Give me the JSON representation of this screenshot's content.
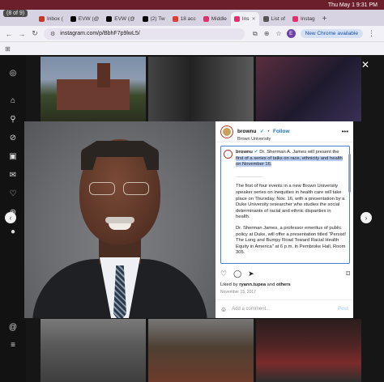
{
  "counter": "(8 of 9)",
  "menubar": {
    "datetime": "Thu May 1  9:31 PM"
  },
  "tabs": [
    {
      "label": "Inbox (",
      "color": "#c0392b",
      "active": false
    },
    {
      "label": "EVW (@",
      "color": "#000000",
      "active": false
    },
    {
      "label": "EVW (@",
      "color": "#000000",
      "active": false
    },
    {
      "label": "(2) Tw",
      "color": "#000000",
      "active": false
    },
    {
      "label": "18 acc",
      "color": "#e53935",
      "active": false
    },
    {
      "label": "Middle",
      "color": "#e1306c",
      "active": false
    },
    {
      "label": "Ins",
      "color": "#e1306c",
      "active": true
    },
    {
      "label": "List of",
      "color": "#555555",
      "active": false
    },
    {
      "label": "Instag",
      "color": "#e1306c",
      "active": false
    }
  ],
  "toolbar": {
    "url": "instagram.com/p/BbhF7p9lwL5/",
    "profile_initial": "E",
    "chrome_available": "New Chrome available"
  },
  "post": {
    "username": "brownu",
    "follow": "Follow",
    "subtitle": "Brown University",
    "caption_lead": "Dr. Sherman A. James will present the",
    "caption_highlight": "first of a series of talks on race, ethnicity and health on November 16.",
    "para2": "The first of four events in a new Brown University speaker series on inequities in health care will take place on Thursday, Nov. 16, with a presentation by a Duke University researcher who studies the social determinants of racial and ethnic disparities in health.",
    "para3": "Dr. Sherman James, a professor emeritus of public policy at Duke, will offer a presentation titled \"Persist! The Long and Bumpy Road Toward Racial Health Equity in America\" at 6 p.m. in Pembroke Hall, Room 305.",
    "liked_by_prefix": "Liked by ",
    "liked_by_user": "ryann.tupea",
    "liked_by_and": " and ",
    "liked_by_others": "others",
    "date": "November 15, 2017",
    "comment_placeholder": "Add a comment...",
    "post_button": "Post"
  }
}
